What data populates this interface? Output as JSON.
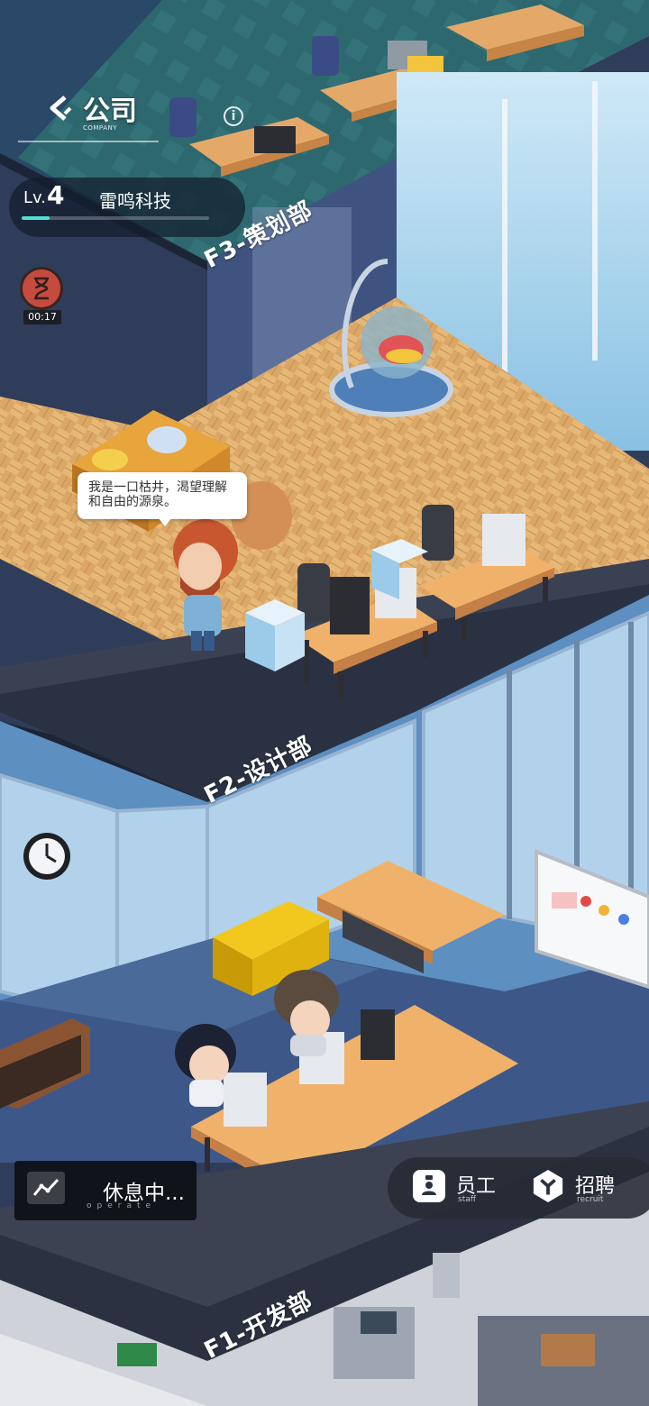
{
  "header": {
    "title": "公司",
    "title_sub": "COMPANY",
    "info_icon": "i"
  },
  "company": {
    "level_prefix": "Lv.",
    "level": "4",
    "name": "雷鸣科技",
    "xp_progress": 0.15
  },
  "timer": {
    "time": "00:17"
  },
  "speech_bubble": {
    "text": "我是一口枯井，渴望理解和自由的源泉。"
  },
  "floors": [
    {
      "label": "F3-策划部"
    },
    {
      "label": "F2-设计部"
    },
    {
      "label": "F1-开发部"
    }
  ],
  "operate": {
    "label": "休息中...",
    "sub": "operate"
  },
  "actions": {
    "staff_label": "员工",
    "staff_sub": "staff",
    "recruit_label": "招聘",
    "recruit_sub": "recruit"
  },
  "colors": {
    "wood_floor": "#d9a564",
    "carpet": "#3e5a85",
    "accent_xp": "#4fe0d2",
    "timer_red": "#c64a3d"
  }
}
